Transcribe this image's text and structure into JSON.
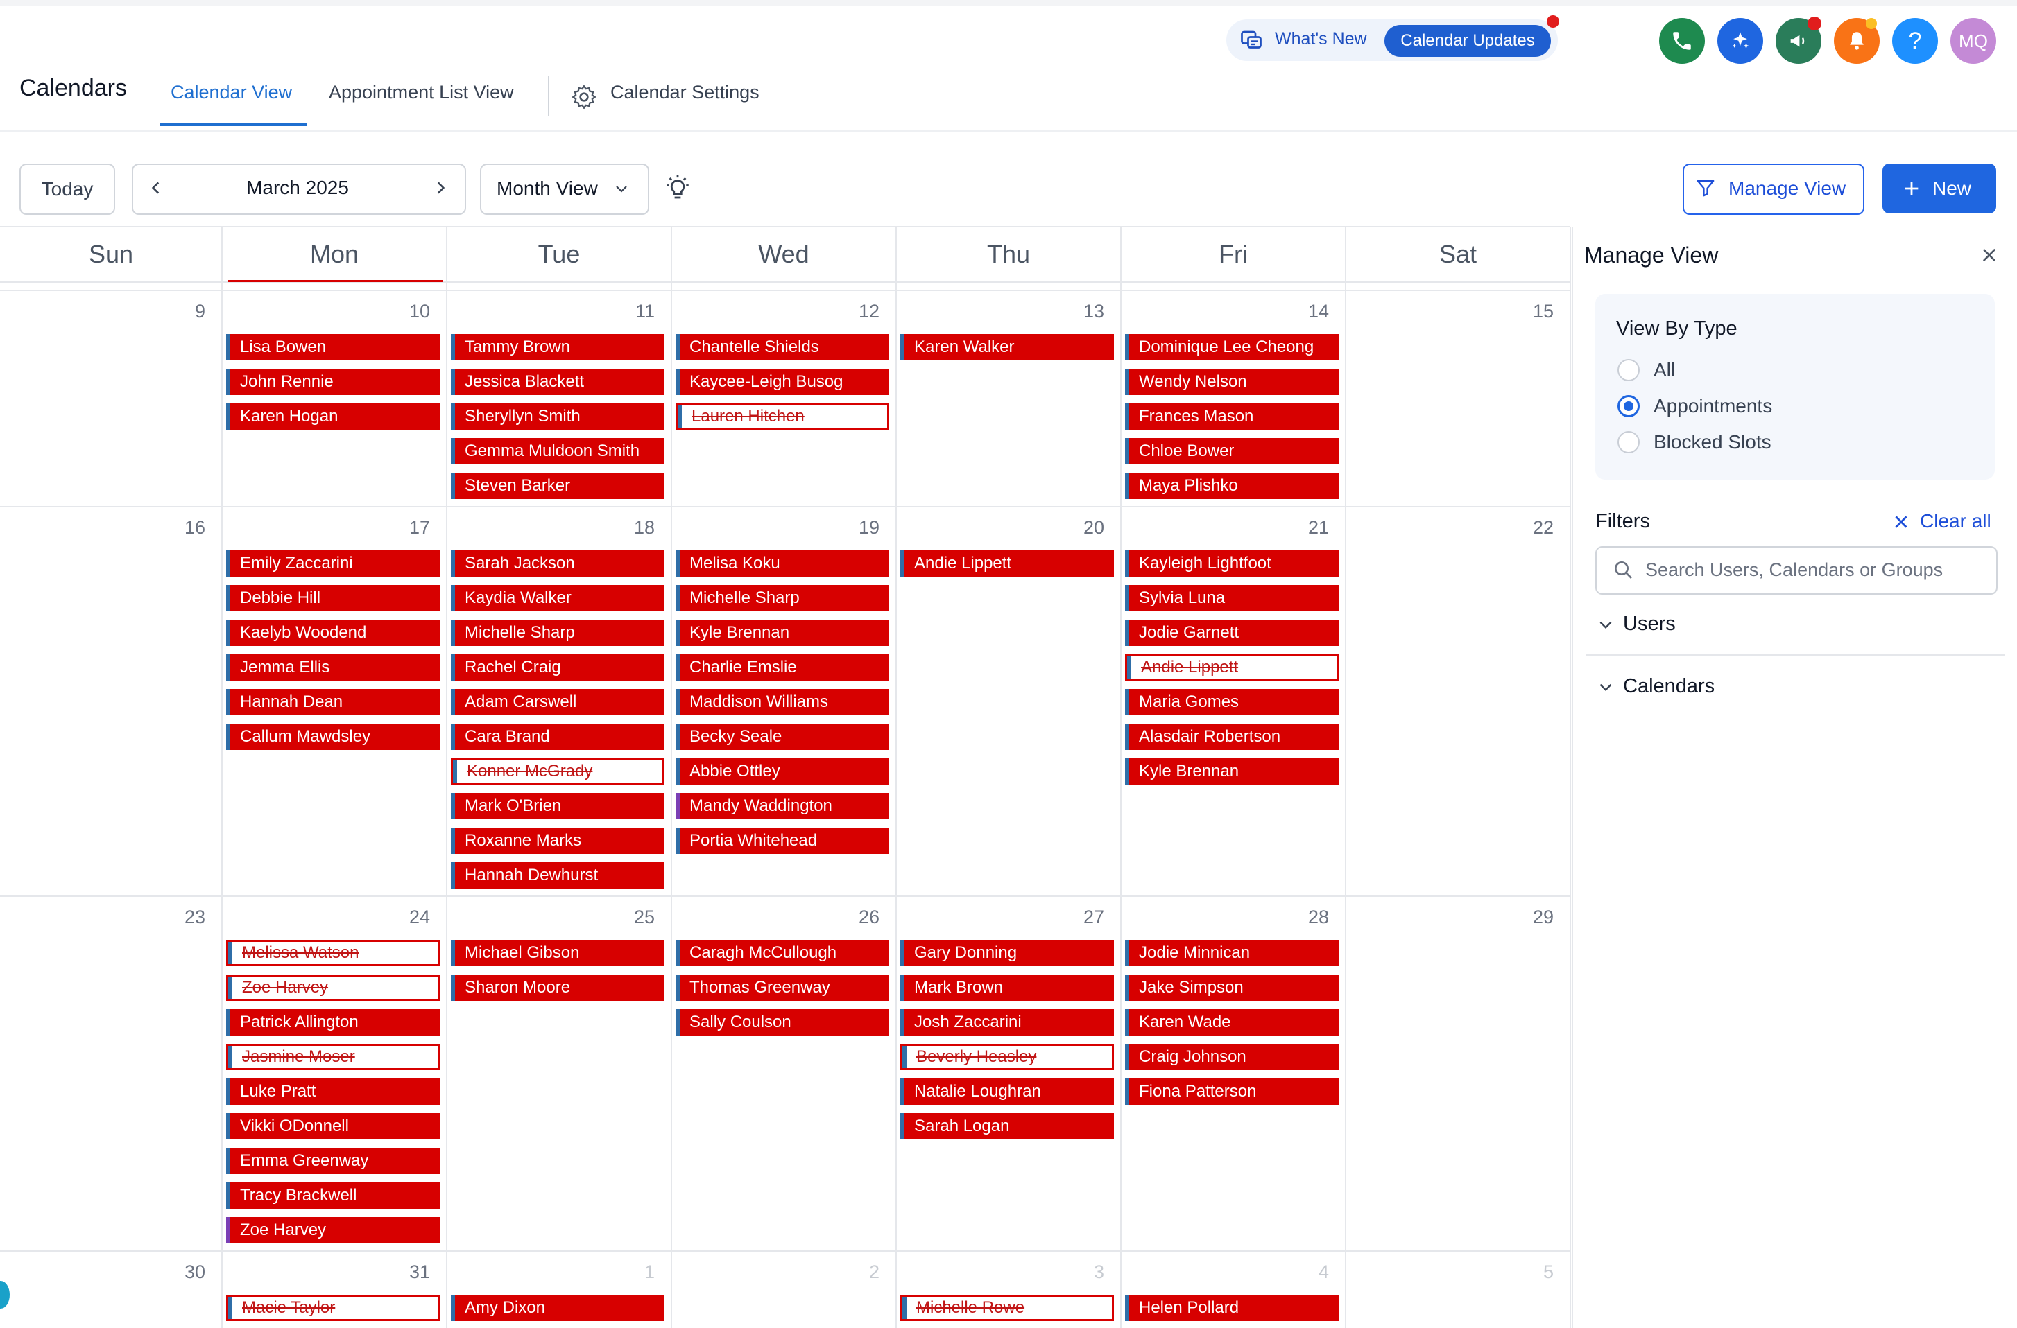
{
  "header": {
    "app_title": "Calendars",
    "tabs": [
      {
        "label": "Calendar View",
        "active": true
      },
      {
        "label": "Appointment List View",
        "active": false
      },
      {
        "label": "Calendar Settings",
        "active": false
      }
    ],
    "whats_new": "What's New",
    "calendar_updates": "Calendar Updates",
    "avatar_initials": "MQ",
    "help_glyph": "?",
    "icons": [
      "phone-icon",
      "sparkle-icon",
      "megaphone-icon",
      "bell-icon",
      "help-icon"
    ]
  },
  "toolbar": {
    "today": "Today",
    "month": "March 2025",
    "view": "Month View",
    "manage_view": "Manage View",
    "new": "New"
  },
  "days": [
    "Sun",
    "Mon",
    "Tue",
    "Wed",
    "Thu",
    "Fri",
    "Sat"
  ],
  "weeks": [
    {
      "dates": [
        "9",
        "10",
        "11",
        "12",
        "13",
        "14",
        "15"
      ],
      "muted": [
        false,
        false,
        false,
        false,
        false,
        false,
        false
      ],
      "events": [
        [],
        [
          {
            "t": "Lisa Bowen"
          },
          {
            "t": "John Rennie"
          },
          {
            "t": "Karen Hogan"
          }
        ],
        [
          {
            "t": "Tammy Brown"
          },
          {
            "t": "Jessica Blackett"
          },
          {
            "t": "Sheryllyn Smith"
          },
          {
            "t": "Gemma Muldoon Smith"
          },
          {
            "t": "Steven  Barker"
          }
        ],
        [
          {
            "t": "Chantelle Shields"
          },
          {
            "t": "Kaycee-Leigh Busog"
          },
          {
            "t": "Lauren Hitchen",
            "c": true
          }
        ],
        [
          {
            "t": "Karen Walker"
          }
        ],
        [
          {
            "t": "Dominique Lee Cheong"
          },
          {
            "t": "Wendy Nelson"
          },
          {
            "t": "Frances Mason"
          },
          {
            "t": "Chloe Bower"
          },
          {
            "t": "Maya Plishko"
          }
        ],
        []
      ]
    },
    {
      "dates": [
        "16",
        "17",
        "18",
        "19",
        "20",
        "21",
        "22"
      ],
      "muted": [
        false,
        false,
        false,
        false,
        false,
        false,
        false
      ],
      "events": [
        [],
        [
          {
            "t": "Emily Zaccarini"
          },
          {
            "t": "Debbie Hill"
          },
          {
            "t": "Kaelyb Woodend"
          },
          {
            "t": "Jemma Ellis"
          },
          {
            "t": "Hannah Dean"
          },
          {
            "t": "Callum Mawdsley"
          }
        ],
        [
          {
            "t": "Sarah Jackson"
          },
          {
            "t": "Kaydia Walker"
          },
          {
            "t": "Michelle Sharp"
          },
          {
            "t": "Rachel Craig"
          },
          {
            "t": "Adam Carswell"
          },
          {
            "t": "Cara Brand"
          },
          {
            "t": "Konner McGrady",
            "c": true
          },
          {
            "t": "Mark O'Brien"
          },
          {
            "t": "Roxanne Marks"
          },
          {
            "t": "Hannah Dewhurst"
          }
        ],
        [
          {
            "t": "Melisa Koku"
          },
          {
            "t": "Michelle Sharp"
          },
          {
            "t": "Kyle Brennan"
          },
          {
            "t": "Charlie  Emslie"
          },
          {
            "t": "Maddison Williams"
          },
          {
            "t": "Becky Seale"
          },
          {
            "t": "Abbie Ottley"
          },
          {
            "t": "Mandy Waddington",
            "p": true
          },
          {
            "t": "Portia Whitehead"
          }
        ],
        [
          {
            "t": "Andie Lippett"
          }
        ],
        [
          {
            "t": "Kayleigh Lightfoot"
          },
          {
            "t": "Sylvia Luna"
          },
          {
            "t": "Jodie Garnett"
          },
          {
            "t": "Andie Lippett",
            "c": true
          },
          {
            "t": "Maria Gomes"
          },
          {
            "t": "Alasdair Robertson"
          },
          {
            "t": "Kyle  Brennan"
          }
        ],
        []
      ]
    },
    {
      "dates": [
        "23",
        "24",
        "25",
        "26",
        "27",
        "28",
        "29"
      ],
      "muted": [
        false,
        false,
        false,
        false,
        false,
        false,
        false
      ],
      "events": [
        [],
        [
          {
            "t": "Melissa Watson",
            "c": true
          },
          {
            "t": "Zoe Harvey",
            "c": true
          },
          {
            "t": "Patrick Allington"
          },
          {
            "t": "Jasmine Moser",
            "c": true
          },
          {
            "t": "Luke  Pratt"
          },
          {
            "t": "Vikki ODonnell"
          },
          {
            "t": "Emma Greenway"
          },
          {
            "t": "Tracy Brackwell"
          },
          {
            "t": "Zoe Harvey",
            "p": true
          }
        ],
        [
          {
            "t": "Michael Gibson"
          },
          {
            "t": "Sharon Moore"
          }
        ],
        [
          {
            "t": "Caragh McCullough"
          },
          {
            "t": "Thomas Greenway"
          },
          {
            "t": "Sally Coulson"
          }
        ],
        [
          {
            "t": "Gary Donning"
          },
          {
            "t": "Mark Brown"
          },
          {
            "t": "Josh  Zaccarini"
          },
          {
            "t": "Beverly Heasley ",
            "c": true
          },
          {
            "t": "Natalie  Loughran"
          },
          {
            "t": "Sarah Logan"
          }
        ],
        [
          {
            "t": "Jodie Minnican"
          },
          {
            "t": "Jake  Simpson"
          },
          {
            "t": "Karen Wade"
          },
          {
            "t": "Craig Johnson"
          },
          {
            "t": "Fiona Patterson"
          }
        ],
        []
      ]
    },
    {
      "dates": [
        "30",
        "31",
        "1",
        "2",
        "3",
        "4",
        "5"
      ],
      "muted": [
        false,
        false,
        true,
        true,
        true,
        true,
        true
      ],
      "events": [
        [],
        [
          {
            "t": "Macie Taylor",
            "c": true
          }
        ],
        [
          {
            "t": "Amy  Dixon"
          }
        ],
        [],
        [
          {
            "t": "Michelle Rowe",
            "c": true
          }
        ],
        [
          {
            "t": "Helen Pollard"
          }
        ],
        []
      ]
    }
  ],
  "manage_view": {
    "title": "Manage View",
    "view_by_type": "View By Type",
    "options": [
      {
        "label": "All",
        "selected": false
      },
      {
        "label": "Appointments",
        "selected": true
      },
      {
        "label": "Blocked Slots",
        "selected": false
      }
    ],
    "filters": "Filters",
    "clear_all": "Clear all",
    "search_placeholder": "Search Users, Calendars or Groups",
    "sections": [
      "Users",
      "Calendars"
    ]
  },
  "colors": {
    "event_red": "#d70000",
    "event_stripe_blue": "#2f6ea8",
    "event_stripe_purple": "#7b3fb5",
    "accent_blue": "#1f66e0"
  }
}
